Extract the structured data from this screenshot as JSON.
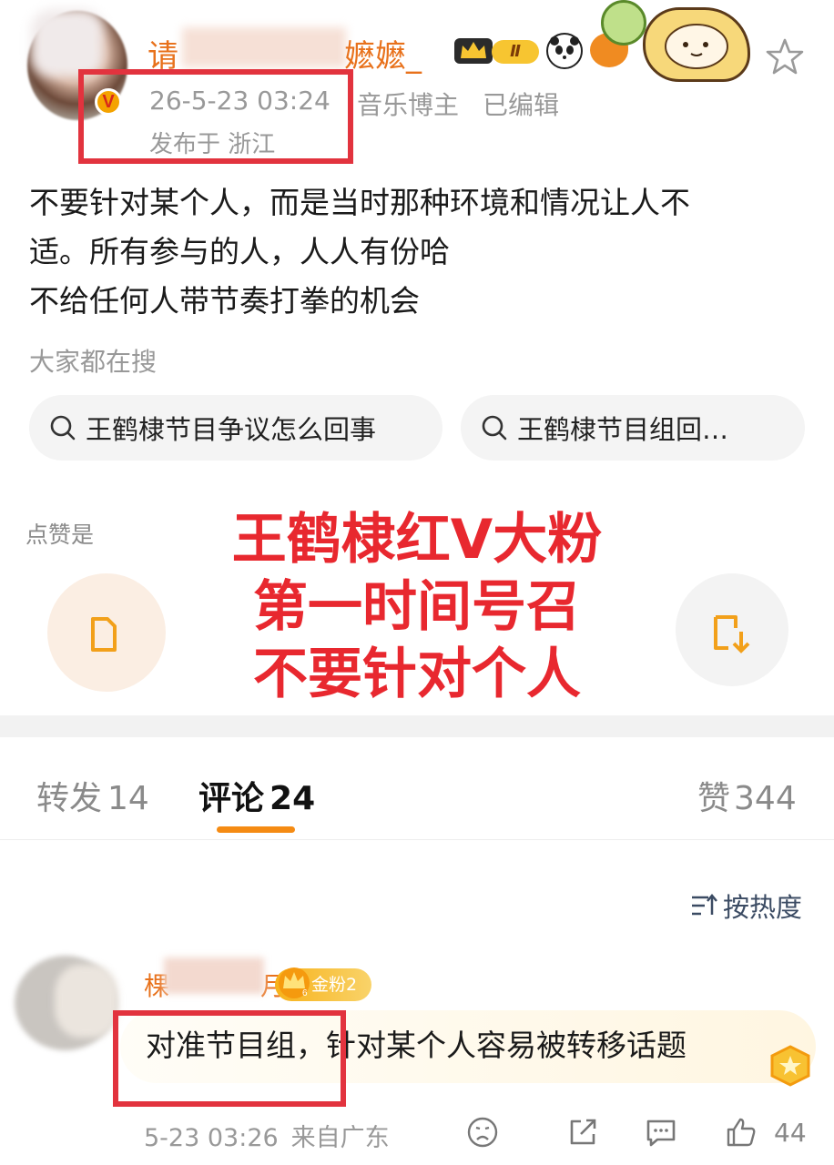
{
  "post": {
    "username_head": "请",
    "username_tail": "嬷嬷_",
    "level_badge": "Ⅱ",
    "verified_mark": "V",
    "timestamp": "26-5-23 03:24",
    "location": "发布于 浙江",
    "tagline": "音乐博主",
    "edited": "已编辑",
    "text_lines": [
      "不要针对某个人，而是当时那种环境和情况让人不",
      "适。所有参与的人，人人有份哈",
      "不给任何人带节奏打拳的机会"
    ]
  },
  "search": {
    "title": "大家都在搜",
    "chips": [
      "王鹤棣节目争议怎么回事",
      "王鹤棣节目组回…"
    ]
  },
  "likes_hint": "点赞是",
  "overlay_lines": [
    "王鹤棣红V大粉",
    "第一时间号召",
    "不要针对个人"
  ],
  "tabs": {
    "repost": "转发",
    "repost_count": "14",
    "comments": "评论",
    "comments_count": "24",
    "likes": "赞",
    "likes_count": "344"
  },
  "sort_label": "按热度",
  "comment": {
    "name_head": "棵",
    "name_tail": "月",
    "fan_badge": "金粉2",
    "fan_level": "6",
    "text": "对准节目组，针对某个人容易被转移话题",
    "time": "5-23 03:26",
    "source": "来自广东",
    "like_count": "44"
  },
  "colors": {
    "accent_orange": "#e8711b",
    "highlight_red": "#e2333e",
    "overlay_red": "#e8282f",
    "tab_indicator": "#f58b13",
    "meta_gray": "#999999"
  },
  "icons": [
    "star-icon",
    "verified-v-icon",
    "crown-icon",
    "panda-emoji-icon",
    "fish-emoji-icon",
    "search-icon",
    "sort-icon",
    "sad-face-icon",
    "share-icon",
    "comment-icon",
    "thumbs-up-icon",
    "medal-icon"
  ]
}
